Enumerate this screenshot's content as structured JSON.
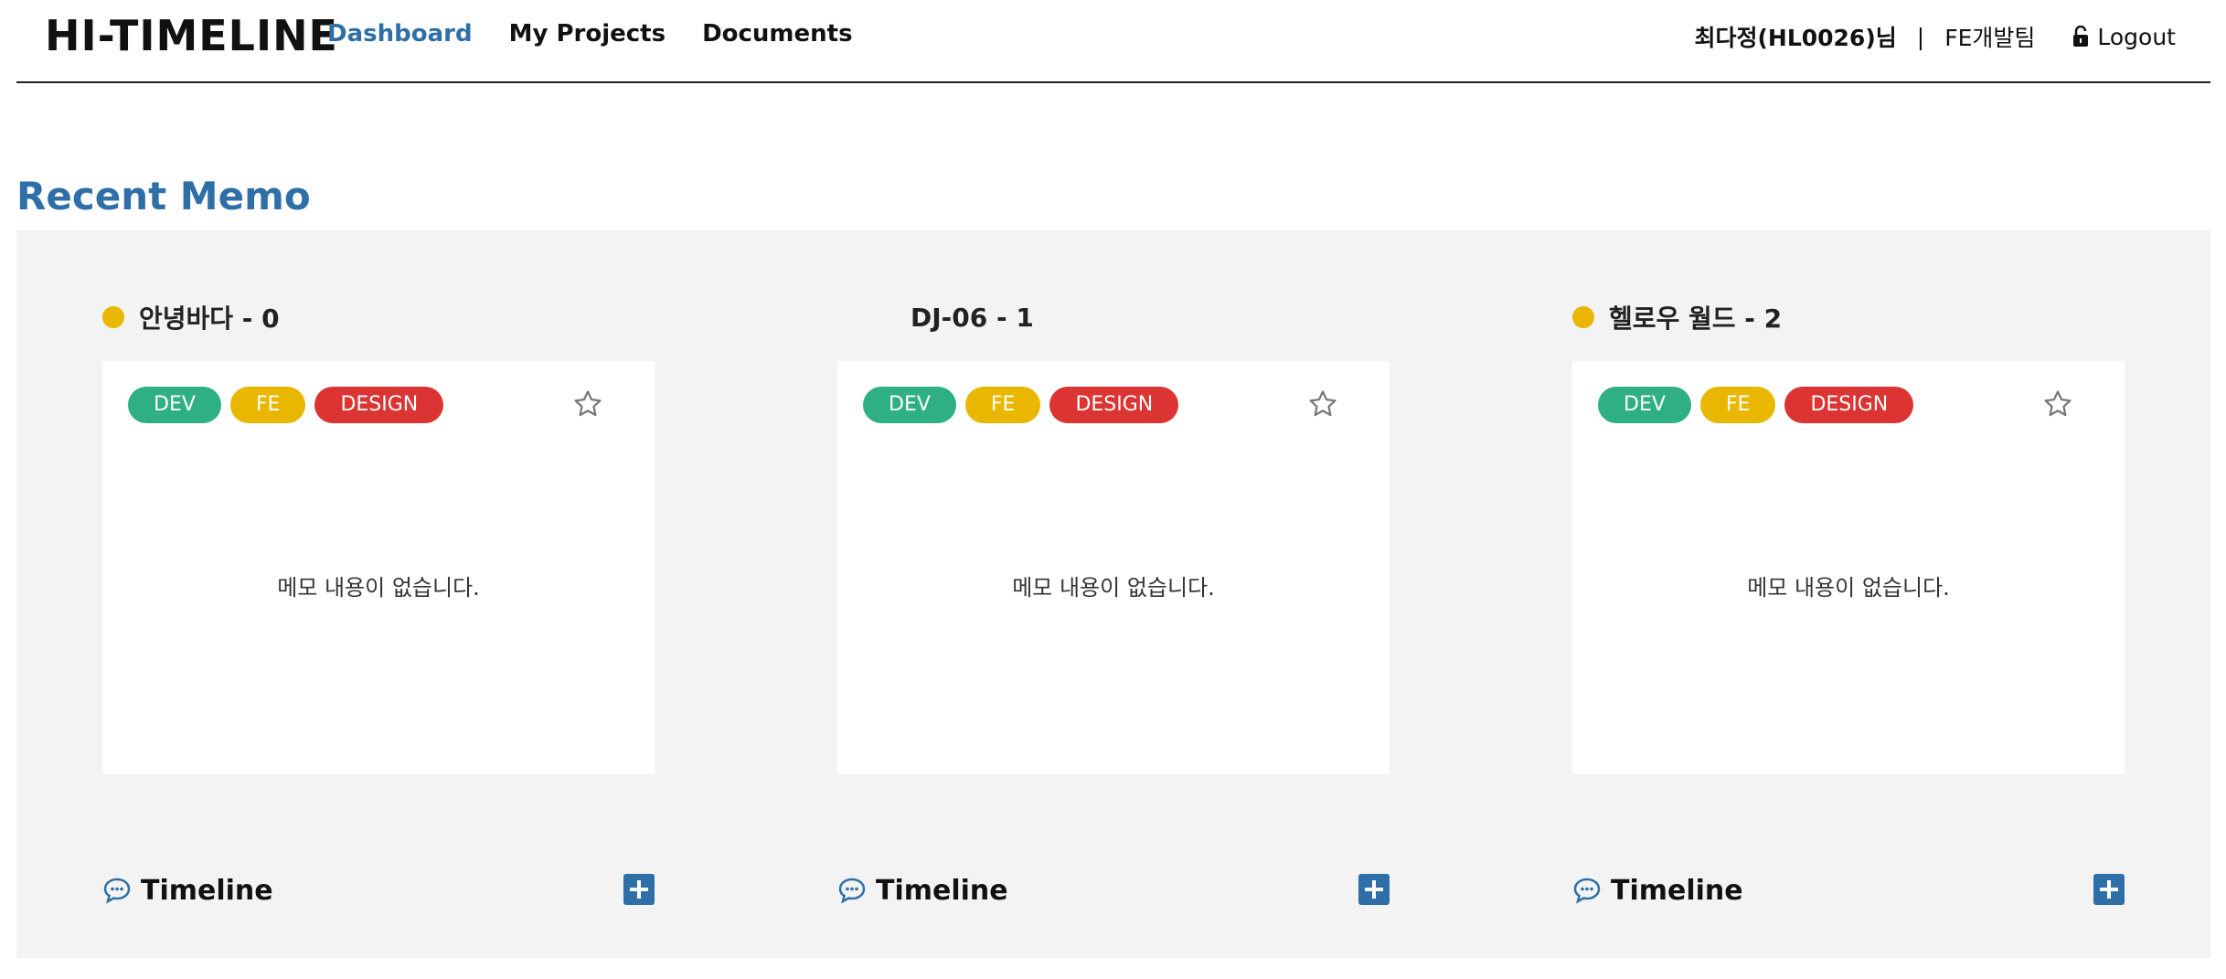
{
  "header": {
    "logo": "HI-TIMELINE",
    "nav": [
      {
        "label": "Dashboard",
        "active": true
      },
      {
        "label": "My Projects",
        "active": false
      },
      {
        "label": "Documents",
        "active": false
      }
    ],
    "user_name": "최다정(HL0026)님",
    "separator": "|",
    "team": "FE개발팀",
    "logout_label": "Logout",
    "logout_icon": "lock-open-icon"
  },
  "section_title": "Recent Memo",
  "memos": [
    {
      "title": "안녕바다 - 0",
      "status_dot": true,
      "tags": [
        "DEV",
        "FE",
        "DESIGN"
      ],
      "empty_text": "메모 내용이 없습니다.",
      "timeline_label": "Timeline"
    },
    {
      "title": "DJ-06 - 1",
      "status_dot": false,
      "tags": [
        "DEV",
        "FE",
        "DESIGN"
      ],
      "empty_text": "메모 내용이 없습니다.",
      "timeline_label": "Timeline"
    },
    {
      "title": "헬로우 월드 - 2",
      "status_dot": true,
      "tags": [
        "DEV",
        "FE",
        "DESIGN"
      ],
      "empty_text": "메모 내용이 없습니다.",
      "timeline_label": "Timeline"
    }
  ],
  "colors": {
    "accent": "#2f6fa8",
    "dev": "#2fb083",
    "fe": "#e9b600",
    "design": "#dc3333",
    "status_dot": "#e9b600",
    "panel_bg": "#f3f3f3"
  }
}
